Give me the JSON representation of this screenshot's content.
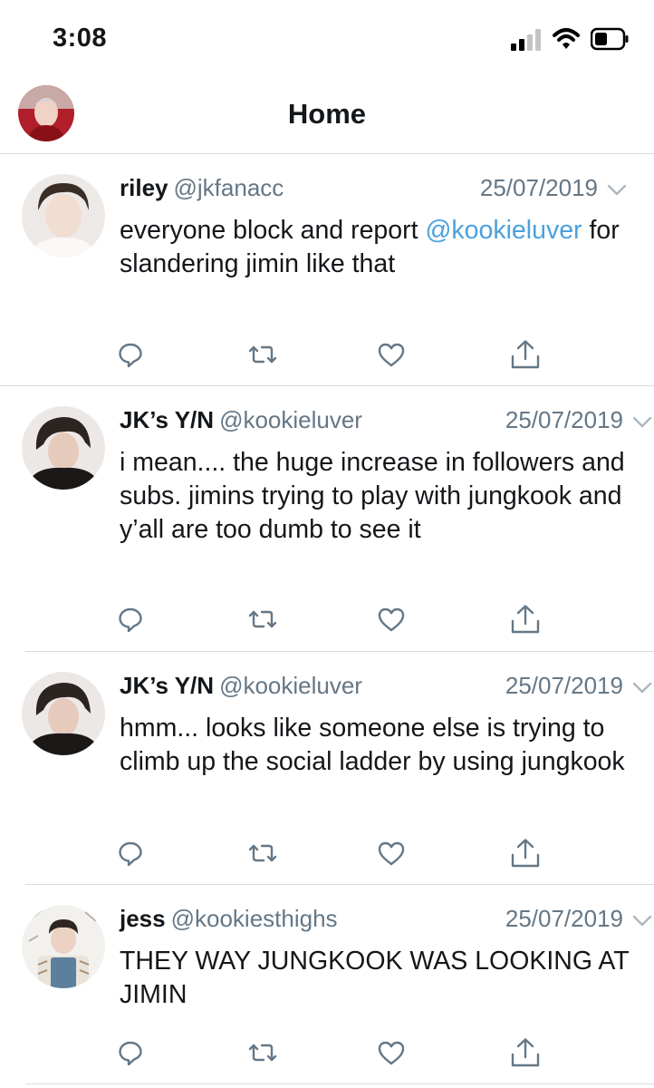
{
  "status_bar": {
    "time": "3:08",
    "icons": [
      "signal-icon",
      "wifi-icon",
      "battery-icon"
    ]
  },
  "nav": {
    "title": "Home",
    "avatar": "profile-avatar"
  },
  "colors": {
    "text": "#14171a",
    "secondary": "#657786",
    "mention": "#4aa1dd",
    "divider": "#d8dce0"
  },
  "tweets": [
    {
      "name": "riley",
      "handle": "@jkfanacc",
      "date": "25/07/2019",
      "text_before": "everyone block and report ",
      "mention": "@kookieluver",
      "text_after": " for slandering jimin like that"
    },
    {
      "name": "JK’s Y/N",
      "handle": "@kookieluver",
      "date": "25/07/2019",
      "text": "i mean.... the huge increase in followers and subs. jimins trying to play with jungkook and y’all are too dumb to see it"
    },
    {
      "name": "JK’s Y/N",
      "handle": "@kookieluver",
      "date": "25/07/2019",
      "text": "hmm... looks like someone else is trying to climb up the social ladder by using jungkook"
    },
    {
      "name": "jess",
      "handle": "@kookiesthighs",
      "date": "25/07/2019",
      "text": "THEY WAY JUNGKOOK WAS LOOKING AT JIMIN"
    }
  ],
  "actions": [
    "reply-icon",
    "retweet-icon",
    "like-icon",
    "share-icon"
  ]
}
